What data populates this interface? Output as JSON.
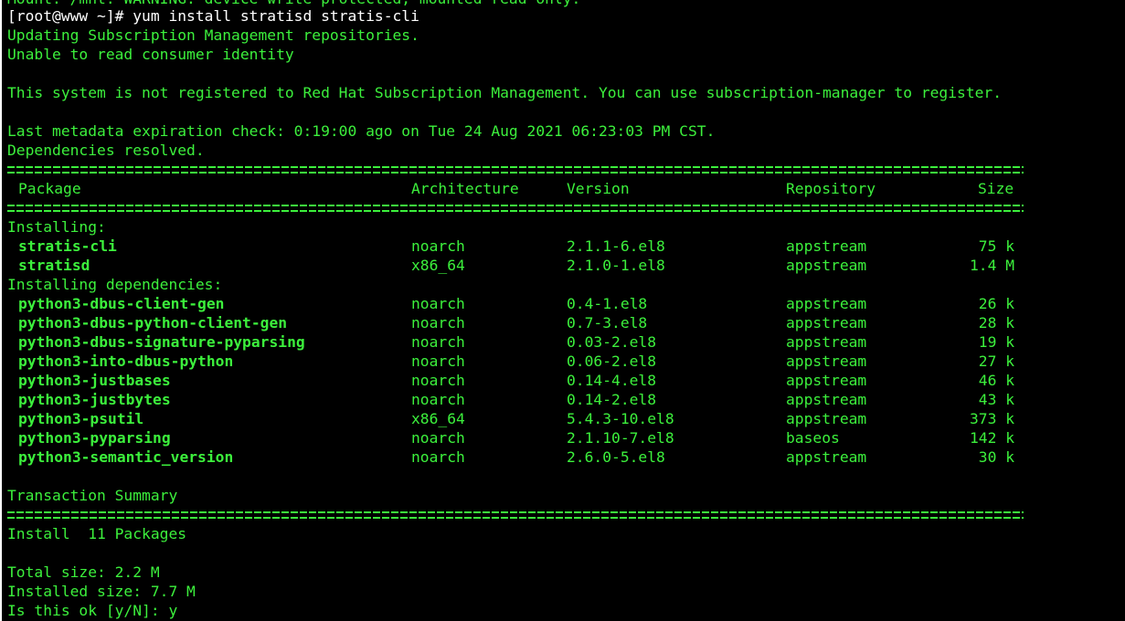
{
  "terminal": {
    "colors": {
      "text": "#3cf03c",
      "background": "#000000",
      "header_border": "#ffffff"
    },
    "cut_top_line": "Mount: /mnt: WARNING: device write-protected, mounted read-only.",
    "prompt": "[root@www ~]#",
    "command": " yum install stratisd stratis-cli",
    "msg1": "Updating Subscription Management repositories.",
    "msg2": "Unable to read consumer identity",
    "msg3": "This system is not registered to Red Hat Subscription Management. You can use subscription-manager to register.",
    "metadata": "Last metadata expiration check: 0:19:00 ago on Tue 24 Aug 2021 06:23:03 PM CST.",
    "deps_resolved": "Dependencies resolved.",
    "table": {
      "headers": {
        "package": "Package",
        "architecture": "Architecture",
        "version": "Version",
        "repository": "Repository",
        "size": "Size"
      },
      "installing_label": "Installing:",
      "installing": [
        {
          "package": "stratis-cli",
          "arch": "noarch",
          "version": "2.1.1-6.el8",
          "repo": "appstream",
          "size": "75 k"
        },
        {
          "package": "stratisd",
          "arch": "x86_64",
          "version": "2.1.0-1.el8",
          "repo": "appstream",
          "size": "1.4 M"
        }
      ],
      "deps_label": "Installing dependencies:",
      "dependencies": [
        {
          "package": "python3-dbus-client-gen",
          "arch": "noarch",
          "version": "0.4-1.el8",
          "repo": "appstream",
          "size": "26 k"
        },
        {
          "package": "python3-dbus-python-client-gen",
          "arch": "noarch",
          "version": "0.7-3.el8",
          "repo": "appstream",
          "size": "28 k"
        },
        {
          "package": "python3-dbus-signature-pyparsing",
          "arch": "noarch",
          "version": "0.03-2.el8",
          "repo": "appstream",
          "size": "19 k"
        },
        {
          "package": "python3-into-dbus-python",
          "arch": "noarch",
          "version": "0.06-2.el8",
          "repo": "appstream",
          "size": "27 k"
        },
        {
          "package": "python3-justbases",
          "arch": "noarch",
          "version": "0.14-4.el8",
          "repo": "appstream",
          "size": "46 k"
        },
        {
          "package": "python3-justbytes",
          "arch": "noarch",
          "version": "0.14-2.el8",
          "repo": "appstream",
          "size": "43 k"
        },
        {
          "package": "python3-psutil",
          "arch": "x86_64",
          "version": "5.4.3-10.el8",
          "repo": "appstream",
          "size": "373 k"
        },
        {
          "package": "python3-pyparsing",
          "arch": "noarch",
          "version": "2.1.10-7.el8",
          "repo": "baseos",
          "size": "142 k"
        },
        {
          "package": "python3-semantic_version",
          "arch": "noarch",
          "version": "2.6.0-5.el8",
          "repo": "appstream",
          "size": "30 k"
        }
      ]
    },
    "summary_label": "Transaction Summary",
    "install_count": "Install  11 Packages",
    "total_size": "Total size: 2.2 M",
    "installed_size": "Installed size: 7.7 M",
    "confirm_prompt": "Is this ok [y/N]: y"
  }
}
